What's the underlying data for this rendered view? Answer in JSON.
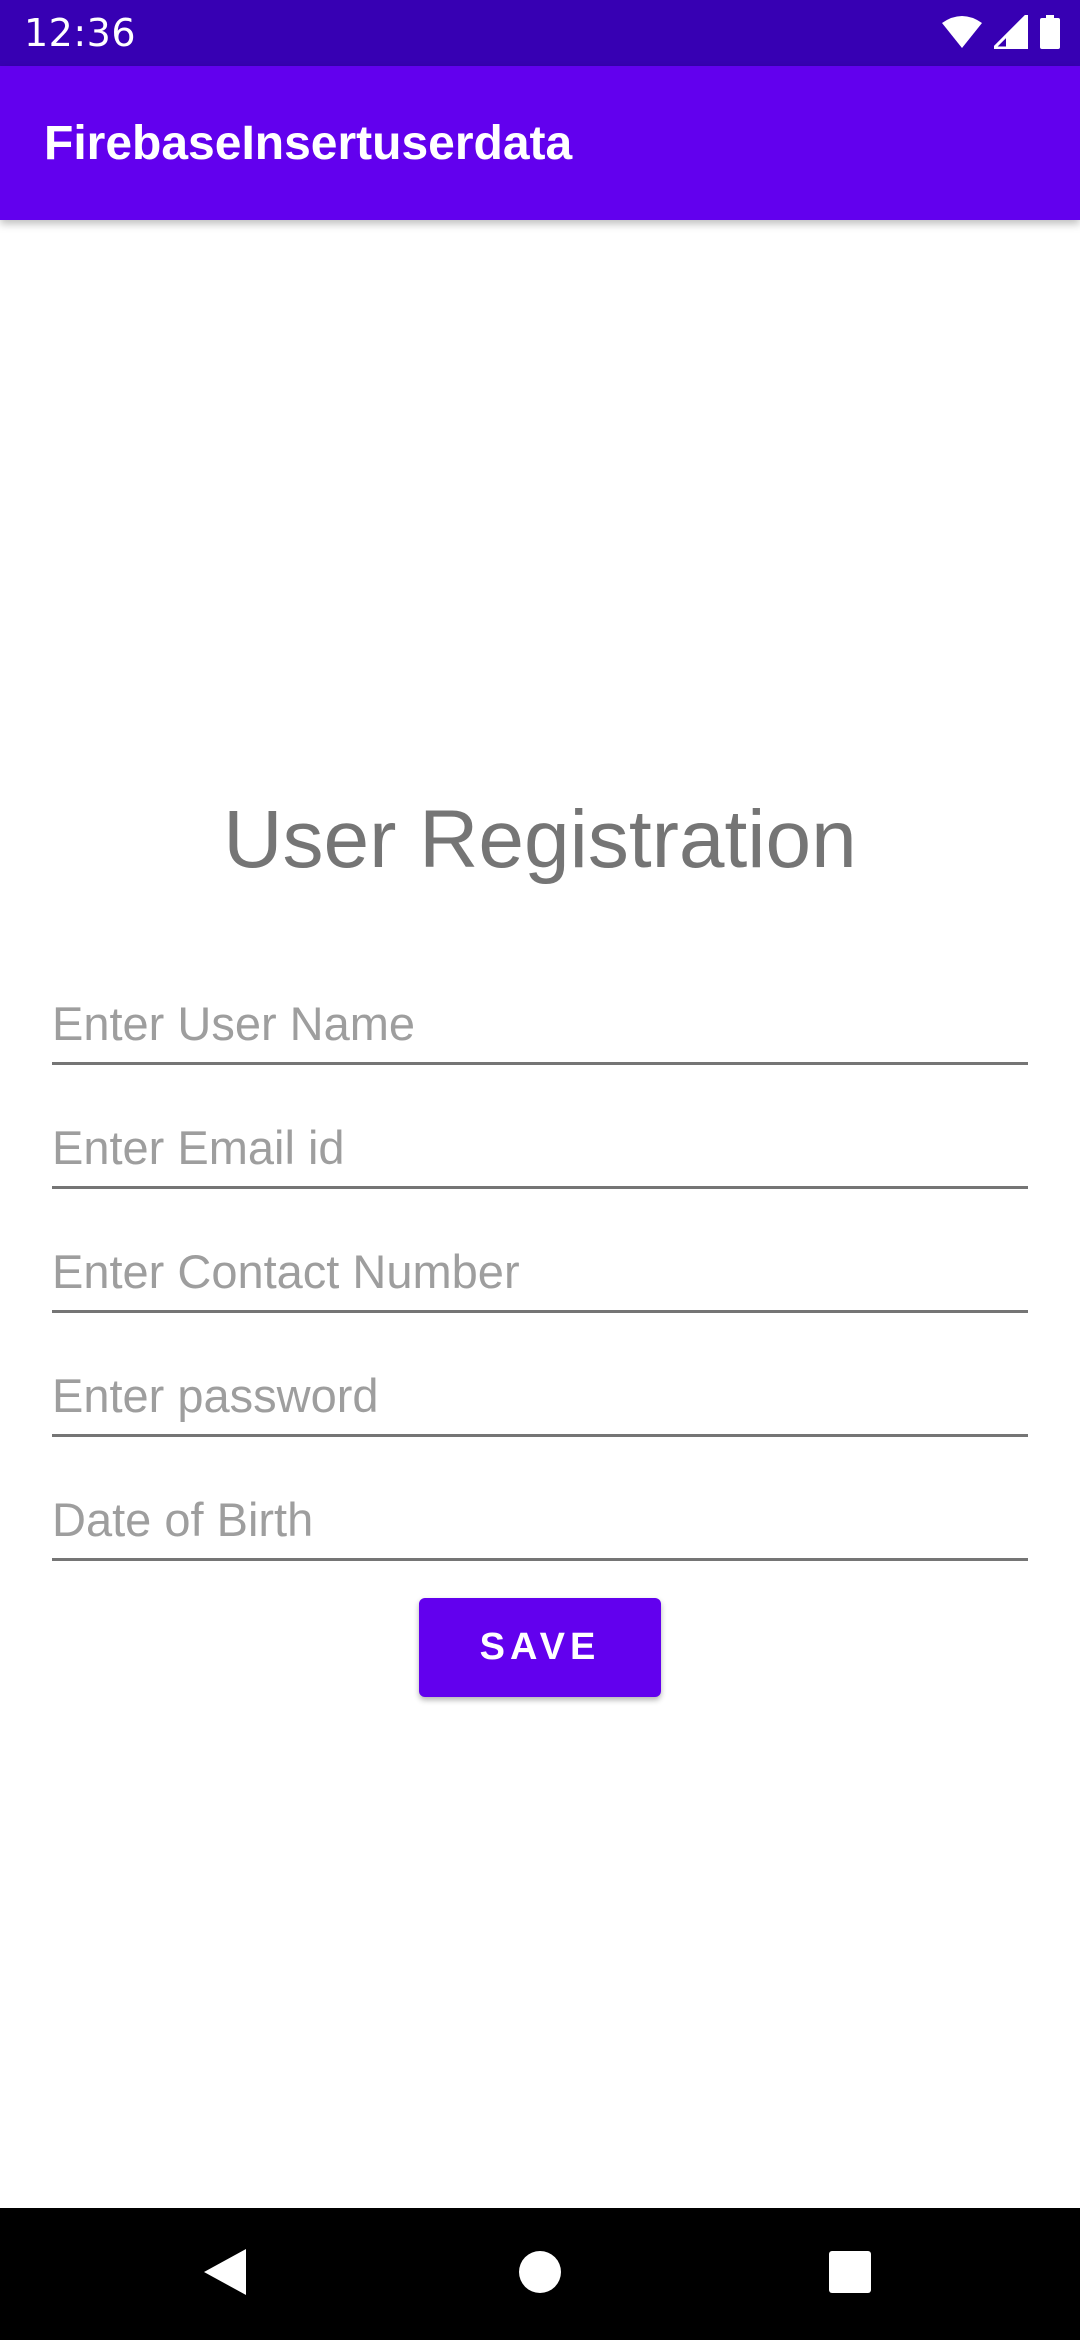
{
  "status_bar": {
    "time": "12:36",
    "icons": [
      "wifi-icon",
      "cellular-signal-icon",
      "battery-icon"
    ]
  },
  "app_bar": {
    "title": "FirebaseInsertuserdata"
  },
  "form": {
    "title": "User Registration",
    "fields": [
      {
        "placeholder": "Enter User Name",
        "value": ""
      },
      {
        "placeholder": "Enter Email id",
        "value": ""
      },
      {
        "placeholder": "Enter Contact Number",
        "value": ""
      },
      {
        "placeholder": "Enter password",
        "value": ""
      },
      {
        "placeholder": "Date of Birth",
        "value": ""
      }
    ],
    "save_label": "SAVE"
  },
  "nav_bar": {
    "icons": [
      "back-icon",
      "home-icon",
      "recents-icon"
    ]
  },
  "colors": {
    "status_bar": "#3700b3",
    "app_bar": "#6200ee",
    "accent": "#6200ee",
    "nav_bar": "#000000"
  }
}
